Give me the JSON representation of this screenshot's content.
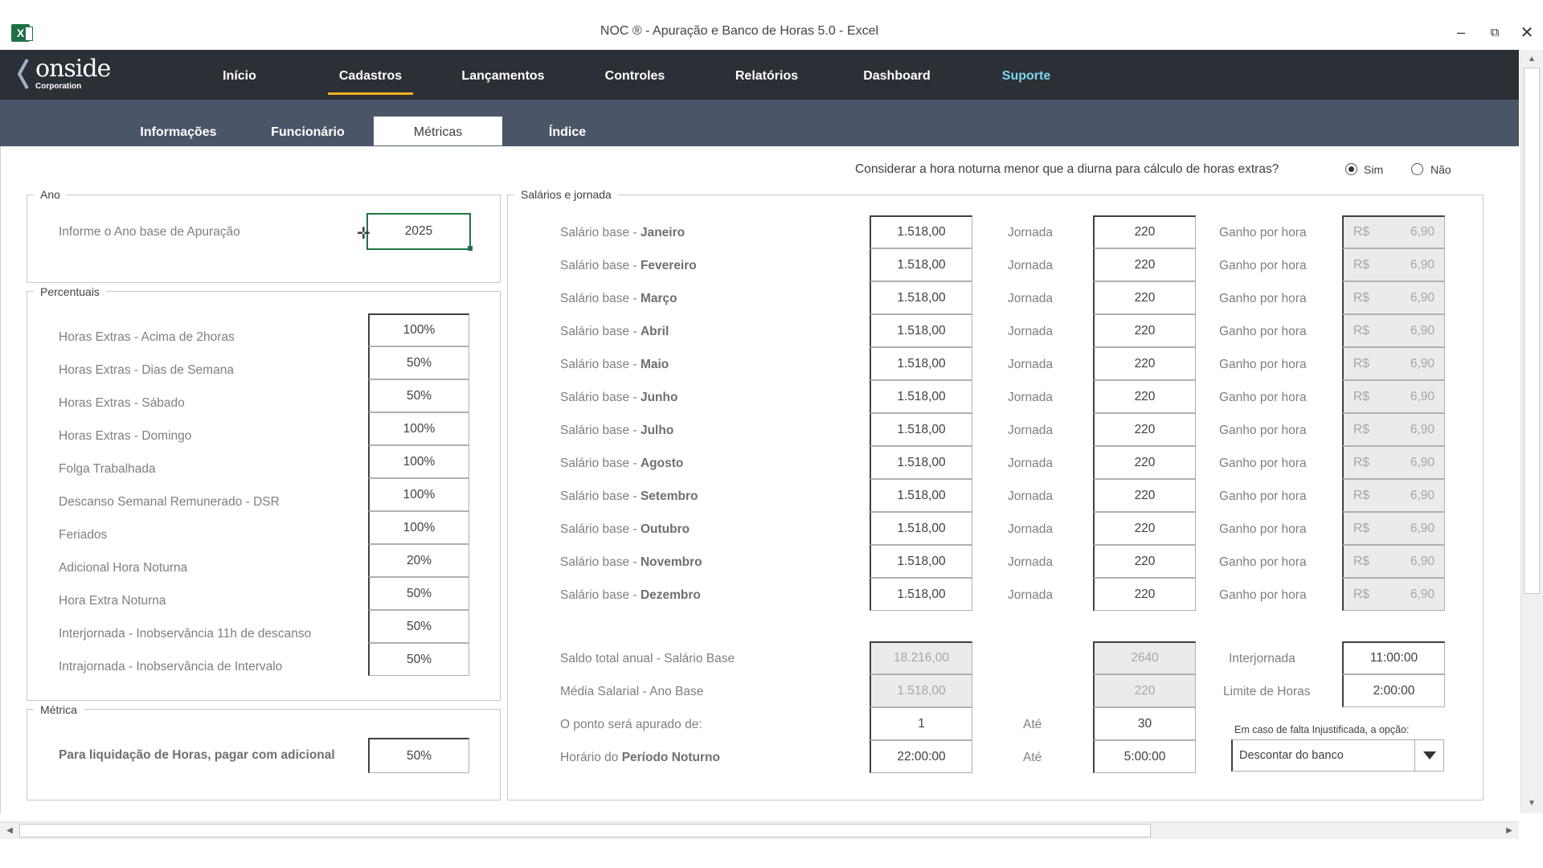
{
  "window": {
    "title": "NOC ® - Apuração e Banco de Horas 5.0 - Excel",
    "app_icon": "X"
  },
  "brand": {
    "logo": "onside",
    "sub": "Corporation"
  },
  "nav": {
    "items": [
      "Início",
      "Cadastros",
      "Lançamentos",
      "Controles",
      "Relatórios",
      "Dashboard",
      "Suporte"
    ],
    "active": "Cadastros",
    "highlight_color": "#f2b01e",
    "support_color": "#7fd3ec"
  },
  "subnav": {
    "items": [
      "Informações",
      "Funcionário",
      "Métricas",
      "Índice"
    ],
    "active": "Métricas"
  },
  "question": {
    "text": "Considerar a hora noturna menor que a diurna para cálculo de horas extras?",
    "yes": "Sim",
    "no": "Não",
    "selected": "Sim"
  },
  "ano": {
    "title": "Ano",
    "label": "Informe o Ano base de Apuração",
    "value": "2025"
  },
  "percentuais": {
    "title": "Percentuais",
    "rows": [
      {
        "label": "Horas Extras - Acima de 2horas",
        "value": "100%"
      },
      {
        "label": "Horas Extras - Dias de Semana",
        "value": "50%"
      },
      {
        "label": "Horas Extras - Sábado",
        "value": "50%"
      },
      {
        "label": "Horas Extras - Domingo",
        "value": "100%"
      },
      {
        "label": "Folga Trabalhada",
        "value": "100%"
      },
      {
        "label": "Descanso Semanal Remunerado - DSR",
        "value": "100%"
      },
      {
        "label": "Feriados",
        "value": "100%"
      },
      {
        "label": "Adicional Hora Noturna",
        "value": "20%"
      },
      {
        "label": "Hora Extra Noturna",
        "value": "50%"
      },
      {
        "label": "Interjornada - Inobservância 11h de descanso",
        "value": "50%"
      },
      {
        "label": "Intrajornada - Inobservância de Intervalo",
        "value": "50%"
      }
    ]
  },
  "metrica": {
    "title": "Métrica",
    "label": "Para liquidação de Horas, pagar com adicional",
    "value": "50%"
  },
  "salarios": {
    "title": "Salários e jornada",
    "prefix": "Salário base - ",
    "jornada_label": "Jornada",
    "ganho_label": "Ganho por hora",
    "currency": "R$",
    "months": [
      {
        "month": "Janeiro",
        "salary": "1.518,00",
        "jornada": "220",
        "ganho": "6,90"
      },
      {
        "month": "Fevereiro",
        "salary": "1.518,00",
        "jornada": "220",
        "ganho": "6,90"
      },
      {
        "month": "Março",
        "salary": "1.518,00",
        "jornada": "220",
        "ganho": "6,90"
      },
      {
        "month": "Abril",
        "salary": "1.518,00",
        "jornada": "220",
        "ganho": "6,90"
      },
      {
        "month": "Maio",
        "salary": "1.518,00",
        "jornada": "220",
        "ganho": "6,90"
      },
      {
        "month": "Junho",
        "salary": "1.518,00",
        "jornada": "220",
        "ganho": "6,90"
      },
      {
        "month": "Julho",
        "salary": "1.518,00",
        "jornada": "220",
        "ganho": "6,90"
      },
      {
        "month": "Agosto",
        "salary": "1.518,00",
        "jornada": "220",
        "ganho": "6,90"
      },
      {
        "month": "Setembro",
        "salary": "1.518,00",
        "jornada": "220",
        "ganho": "6,90"
      },
      {
        "month": "Outubro",
        "salary": "1.518,00",
        "jornada": "220",
        "ganho": "6,90"
      },
      {
        "month": "Novembro",
        "salary": "1.518,00",
        "jornada": "220",
        "ganho": "6,90"
      },
      {
        "month": "Dezembro",
        "salary": "1.518,00",
        "jornada": "220",
        "ganho": "6,90"
      }
    ]
  },
  "totals": {
    "saldo_label": "Saldo total anual - Salário Base",
    "saldo_value": "18.216,00",
    "saldo_jornada": "2640",
    "media_label": "Média Salarial - Ano Base",
    "media_value": "1.518,00",
    "media_jornada": "220",
    "interjornada_label": "Interjornada",
    "interjornada_value": "11:00:00",
    "limite_label": "Limite de Horas",
    "limite_value": "2:00:00",
    "ponto_label": "O ponto será apurado de:",
    "ponto_from": "1",
    "ate_label": "Até",
    "ponto_to": "30",
    "noturno_label_pre": "Horário do ",
    "noturno_label_bold": "Período Noturno",
    "noturno_from": "22:00:00",
    "noturno_to": "5:00:00",
    "falta_label": "Em caso de falta Injustificada, a opção:",
    "falta_value": "Descontar do banco"
  }
}
